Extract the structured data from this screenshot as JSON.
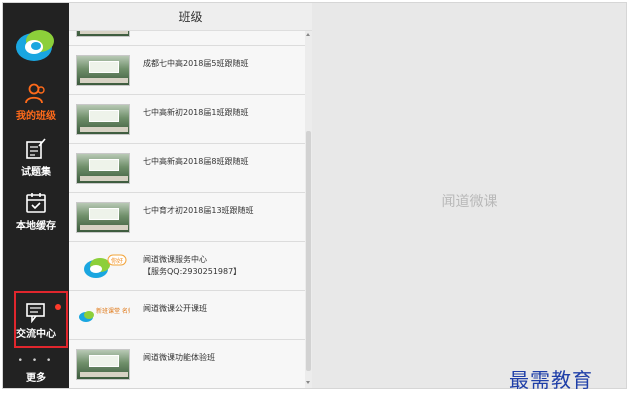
{
  "sidebar": {
    "nav": [
      {
        "label": "我的班级",
        "icon": "my-class-icon"
      },
      {
        "label": "试题集",
        "icon": "question-set-icon"
      },
      {
        "label": "本地缓存",
        "icon": "local-cache-icon"
      },
      {
        "label": "交流中心",
        "icon": "chat-icon"
      },
      {
        "label": "更多",
        "icon": "more-icon"
      }
    ],
    "more_dots": "• • •"
  },
  "panel": {
    "title": "班级",
    "rows": [
      {
        "name": "成都七中高2018届5班跟随班"
      },
      {
        "name": "七中高新初2018届1班跟随班"
      },
      {
        "name": "七中高新高2018届8班跟随班"
      },
      {
        "name": "七中育才初2018届13班跟随班"
      },
      {
        "name": "闻道微课服务中心",
        "sub": "【服务QQ:2930251987】",
        "bubble": "你好"
      },
      {
        "name": "闻道微课公开课班",
        "thumb_text": "新班课堂 名师课堂"
      },
      {
        "name": "闻道微课功能体验班"
      }
    ]
  },
  "content": {
    "placeholder": "闻道微课"
  },
  "watermark": "最需教育",
  "colors": {
    "sidebar_bg": "#222222",
    "active_label": "#ff6a1a",
    "highlight_border": "#e0262d",
    "watermark": "#1f3fa8"
  }
}
